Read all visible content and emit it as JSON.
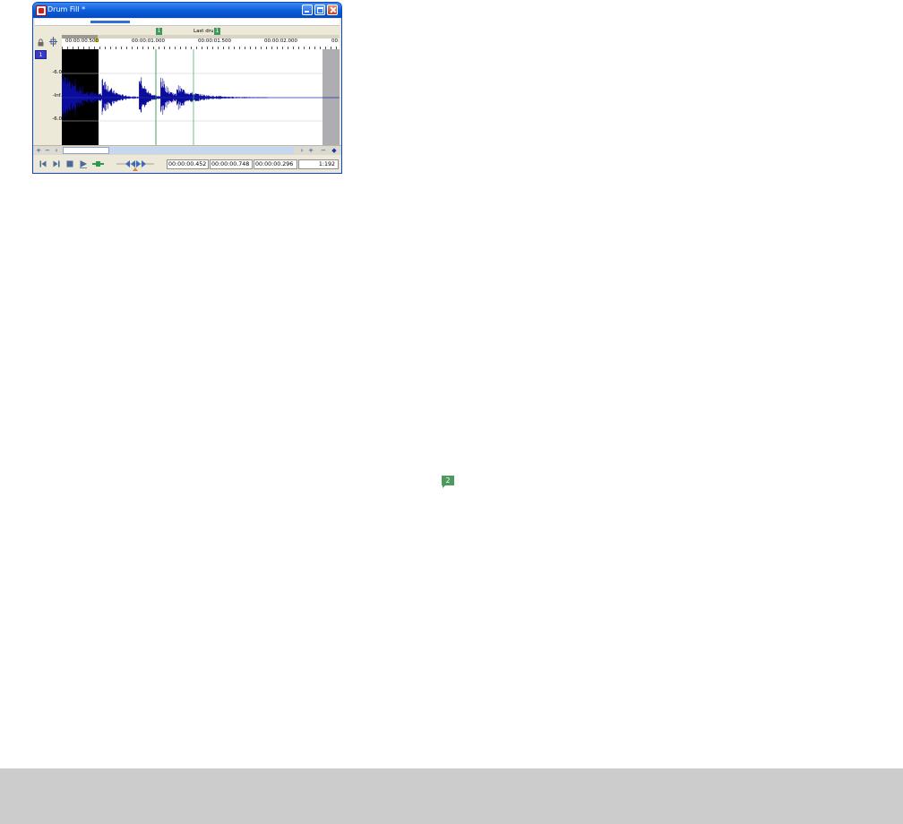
{
  "window": {
    "title": "Drum Fill *",
    "buttons": {
      "minimize": "minimize",
      "maximize": "maximize",
      "close": "close"
    }
  },
  "ruler": {
    "labels": [
      "00:00:00.500",
      "00:00:01.000",
      "00:00:01.500",
      "00:00:02.000",
      "00:"
    ]
  },
  "region": {
    "label": "Last drum",
    "start_flag": "1",
    "end_flag": "1"
  },
  "channel": {
    "number": "1"
  },
  "db_scale": [
    "-6.0",
    "-Inf.",
    "-6.0"
  ],
  "transport": {
    "selection_start": "00:00:00.452",
    "selection_end": "00:00:00.748",
    "selection_length": "00:00:00.296",
    "zoom_ratio": "1:192"
  },
  "floating_region_flag": "2",
  "colors": {
    "waveform": "#0b0b9c",
    "region_marker": "#3e9a5a",
    "title_bar": "#0a5bd8",
    "footer": "#cccccc"
  },
  "icons": [
    "lock-icon",
    "snap-icon",
    "go-to-start-icon",
    "go-to-end-icon",
    "stop-icon",
    "play-icon",
    "play-looped-icon",
    "scrub-icon",
    "zoom-in-icon",
    "zoom-out-icon"
  ]
}
